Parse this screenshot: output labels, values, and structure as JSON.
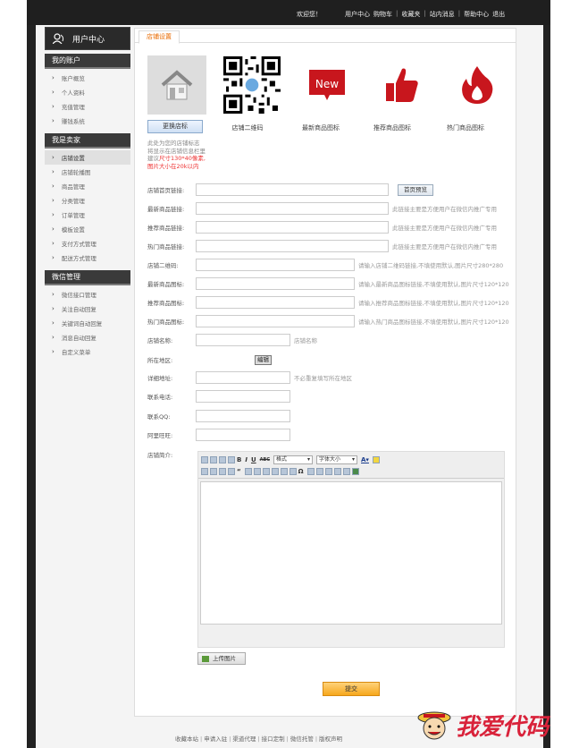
{
  "topbar": {
    "welcome": "欢迎您！",
    "nav": [
      "用户中心",
      "购物车",
      "收藏夹",
      "站内消息",
      "帮助中心",
      "退出"
    ]
  },
  "sidebar": {
    "title": "用户中心",
    "sections": [
      {
        "title": "我的账户",
        "items": [
          "账户概览",
          "个人资料",
          "充值管理",
          "赚钱系统"
        ]
      },
      {
        "title": "我是卖家",
        "items": [
          "店铺设置",
          "店铺轮播图",
          "商品管理",
          "分类管理",
          "订单管理",
          "模板设置",
          "支付方式管理",
          "配送方式管理"
        ]
      },
      {
        "title": "微信管理",
        "items": [
          "微信接口管理",
          "关注自动回复",
          "关键词自动回复",
          "消息自动回复",
          "自定义菜单"
        ]
      }
    ],
    "active_item": "店铺设置"
  },
  "tab": {
    "label": "店铺设置"
  },
  "icons": {
    "change_button": "更换店标",
    "qr_label": "店铺二维码",
    "new_label": "最新商品图标",
    "new_text": "New",
    "recommend_label": "推荐商品图标",
    "hot_label": "热门商品图标"
  },
  "hint": {
    "line1": "此处为您的店铺标志",
    "line2": "将显示在店铺信息栏里",
    "line3_prefix": "建议",
    "line3_red": "尺寸130*40像素,",
    "line4_red": "图片大小在20k以内"
  },
  "form": {
    "home_link": {
      "label": "店铺首页链接:",
      "button": "首页预览"
    },
    "new_link": {
      "label": "最新商品链接:",
      "note": "此链接主要是方便用户在微信内推广专用"
    },
    "rec_link": {
      "label": "推荐商品链接:",
      "note": "此链接主要是方便用户在微信内推广专用"
    },
    "hot_link": {
      "label": "热门商品链接:",
      "note": "此链接主要是方便用户在微信内推广专用"
    },
    "qr": {
      "label": "店铺二维码:",
      "note": "请输入店铺二维码链接,不填使用默认,图片尺寸280*280"
    },
    "new_icon": {
      "label": "最新商品图标:",
      "note": "请输入最新商品图标链接,不填使用默认,图片尺寸120*120"
    },
    "rec_icon": {
      "label": "推荐商品图标:",
      "note": "请输入推荐商品图标链接,不填使用默认,图片尺寸120*120"
    },
    "hot_icon": {
      "label": "热门商品图标:",
      "note": "请输入热门商品图标链接,不填使用默认,图片尺寸120*120"
    },
    "name": {
      "label": "店铺名称:",
      "note": "店铺名称"
    },
    "region": {
      "label": "所在地区:",
      "button": "编辑"
    },
    "address": {
      "label": "详细地址:",
      "note": "不必重复填写所在地区"
    },
    "phone": {
      "label": "联系电话:"
    },
    "qq": {
      "label": "联系QQ:"
    },
    "wangwang": {
      "label": "阿里旺旺:"
    },
    "intro": {
      "label": "店铺简介:"
    }
  },
  "editor": {
    "format_select": "格式",
    "size_select": "字体大小",
    "upload_button": "上传图片"
  },
  "submit_button": "提交",
  "footer": [
    "收藏本站",
    "申请入驻",
    "渠道代理",
    "接口定制",
    "微信托管",
    "版权声明"
  ],
  "watermark": "我爱代码"
}
